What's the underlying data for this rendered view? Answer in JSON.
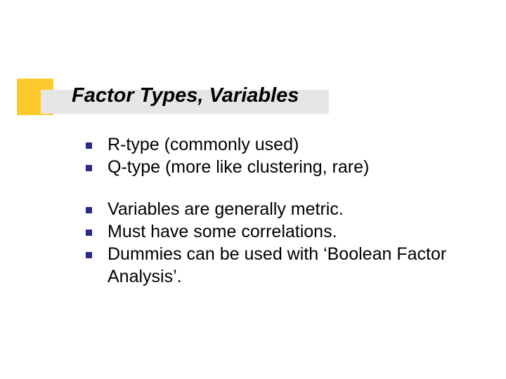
{
  "title": "Factor Types, Variables",
  "group1": {
    "items": [
      "R-type (commonly used)",
      "Q-type (more like clustering, rare)"
    ]
  },
  "group2": {
    "items": [
      "Variables are generally metric.",
      "Must have some correlations.",
      "Dummies can be used with ‘Boolean Factor Analysis’."
    ]
  }
}
